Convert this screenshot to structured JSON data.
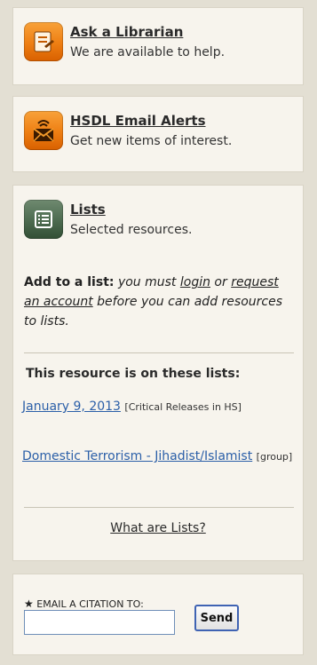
{
  "ask": {
    "title": "Ask a Librarian",
    "subtitle": "We are available to help.",
    "icon": "librarian-icon"
  },
  "alerts": {
    "title": "HSDL Email Alerts",
    "subtitle": "Get new items of interest.",
    "icon": "email-alert-icon"
  },
  "lists": {
    "title": "Lists",
    "subtitle": "Selected resources.",
    "icon": "list-icon",
    "add_lead": "Add to a list:",
    "add_text1": "you must",
    "login_link": "login",
    "add_text2": "or",
    "request_link": "request an account",
    "add_text3": "before you can add resources to lists.",
    "on_lists_heading": "This resource is on these lists:",
    "items": [
      {
        "link": "January 9, 2013",
        "tag": "[Critical Releases in HS]"
      },
      {
        "link": "Domestic Terrorism - Jihadist/Islamist",
        "tag": "[group]"
      }
    ],
    "what_link": "What are Lists?"
  },
  "citation": {
    "label": "EMAIL A CITATION TO:",
    "required_mark": "★",
    "input_value": "",
    "send_label": "Send"
  },
  "colors": {
    "link_blue": "#2b5fa8",
    "panel_bg": "#f7f4ed",
    "page_bg": "#e3dfd3"
  }
}
